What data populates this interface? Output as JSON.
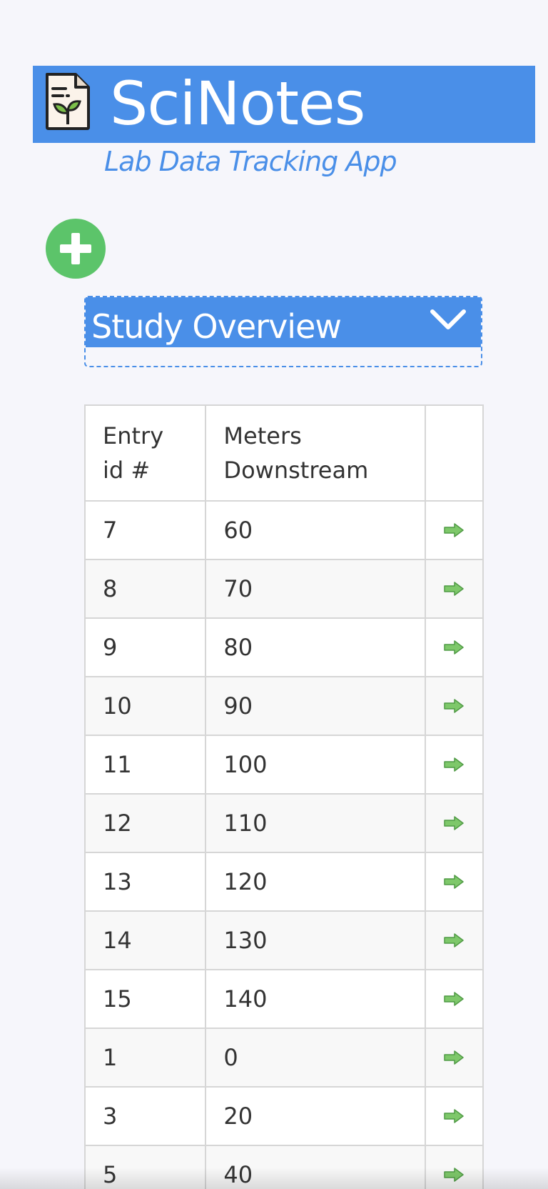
{
  "header": {
    "title": "SciNotes",
    "subtitle": "Lab Data Tracking App",
    "logo_icon": "document-sprout-icon"
  },
  "add_button": {
    "icon": "plus-icon",
    "color": "#5cc46a"
  },
  "study": {
    "title": "Study Overview",
    "toggle_icon": "chevron-down-icon"
  },
  "table": {
    "columns": [
      "Entry id #",
      "Meters Downstream",
      ""
    ],
    "rows": [
      {
        "id": "7",
        "meters": "60"
      },
      {
        "id": "8",
        "meters": "70"
      },
      {
        "id": "9",
        "meters": "80"
      },
      {
        "id": "10",
        "meters": "90"
      },
      {
        "id": "11",
        "meters": "100"
      },
      {
        "id": "12",
        "meters": "110"
      },
      {
        "id": "13",
        "meters": "120"
      },
      {
        "id": "14",
        "meters": "130"
      },
      {
        "id": "15",
        "meters": "140"
      },
      {
        "id": "1",
        "meters": "0"
      },
      {
        "id": "3",
        "meters": "20"
      },
      {
        "id": "5",
        "meters": "40"
      }
    ],
    "row_action_icon": "arrow-right-icon"
  },
  "colors": {
    "accent": "#4a8fe8",
    "add": "#5cc46a",
    "background": "#f6f6fb"
  }
}
